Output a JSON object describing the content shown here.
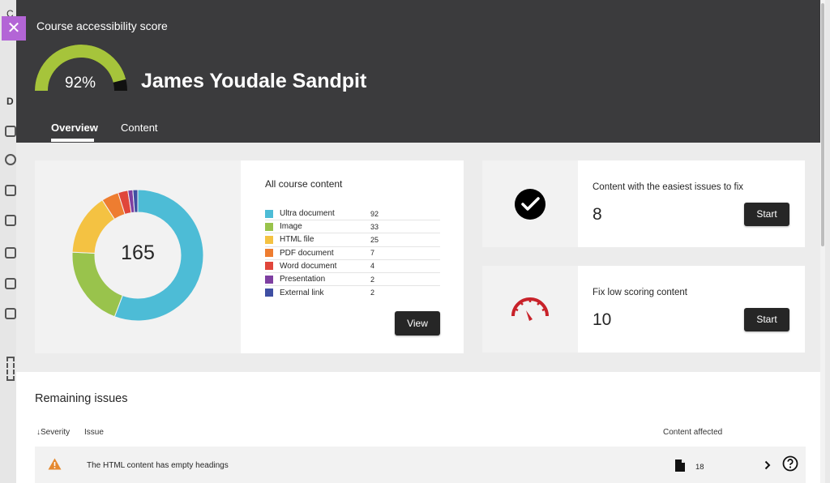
{
  "header": {
    "score_label": "Course accessibility score",
    "score_value": "92%",
    "score_fraction": 0.92,
    "course_title": "James Youdale Sandpit",
    "close_icon": "close-icon",
    "tabs": [
      {
        "label": "Overview",
        "active": true
      },
      {
        "label": "Content",
        "active": false
      }
    ]
  },
  "content_summary": {
    "title": "All course content",
    "total": "165",
    "view_label": "View",
    "items": [
      {
        "label": "Ultra document",
        "count": "92",
        "color": "#4dbcd6"
      },
      {
        "label": "Image",
        "count": "33",
        "color": "#99c34c"
      },
      {
        "label": "HTML file",
        "count": "25",
        "color": "#f4c242"
      },
      {
        "label": "PDF document",
        "count": "7",
        "color": "#ee7d30"
      },
      {
        "label": "Word document",
        "count": "4",
        "color": "#e0463b"
      },
      {
        "label": "Presentation",
        "count": "2",
        "color": "#7e3fa1"
      },
      {
        "label": "External link",
        "count": "2",
        "color": "#3f4fa3"
      }
    ]
  },
  "actions": [
    {
      "label": "Content with the easiest issues to fix",
      "count": "8",
      "button": "Start",
      "icon": "checkmark-circle-icon"
    },
    {
      "label": "Fix low scoring content",
      "count": "10",
      "button": "Start",
      "icon": "speedometer-icon"
    }
  ],
  "issues": {
    "title": "Remaining issues",
    "columns": {
      "severity": "Severity",
      "issue": "Issue",
      "affected": "Content affected"
    },
    "rows": [
      {
        "issue": "The HTML content has empty headings",
        "affected": "18",
        "severity_icon": "warning-icon"
      }
    ]
  },
  "colors": {
    "header_bg": "#3b3b3d",
    "gauge_fill": "#a6c43b",
    "accent_close": "#b365d6",
    "dial_red": "#c8222a",
    "warning_orange": "#e5892f"
  }
}
